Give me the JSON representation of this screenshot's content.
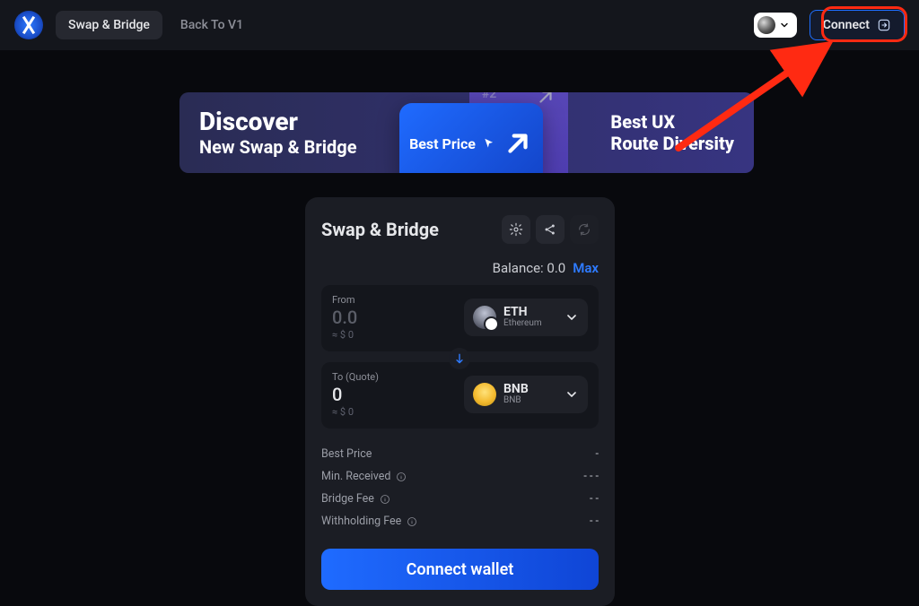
{
  "header": {
    "nav_swap_bridge": "Swap & Bridge",
    "nav_back_v1": "Back To V1",
    "connect_label": "Connect"
  },
  "banner": {
    "title": "Discover",
    "subtitle": "New Swap & Bridge",
    "card_back_label": "#2",
    "card_front_label": "Best Price",
    "right_line1": "Best UX",
    "right_line2": "Route Diversity"
  },
  "swap": {
    "title": "Swap & Bridge",
    "balance_label": "Balance: 0.0",
    "max_label": "Max",
    "from": {
      "label": "From",
      "amount": "0.0",
      "usd": "≈ $ 0",
      "token_symbol": "ETH",
      "token_chain": "Ethereum"
    },
    "to": {
      "label": "To (Quote)",
      "amount": "0",
      "usd": "≈ $ 0",
      "token_symbol": "BNB",
      "token_chain": "BNB"
    },
    "rows": {
      "best_price_k": "Best Price",
      "best_price_v": "-",
      "min_recv_k": "Min. Received",
      "min_recv_v": "- - -",
      "bridge_fee_k": "Bridge Fee",
      "bridge_fee_v": "- -",
      "withholding_k": "Withholding Fee",
      "withholding_v": "- -"
    },
    "cta": "Connect wallet"
  }
}
